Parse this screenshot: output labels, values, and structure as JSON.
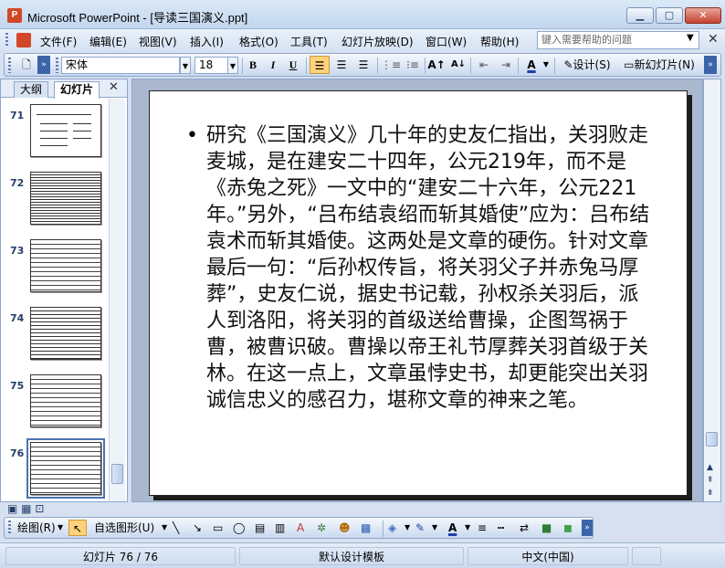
{
  "window": {
    "title": "Microsoft PowerPoint - [导读三国演义.ppt]",
    "app_icon_letter": "P"
  },
  "menu": {
    "items": [
      "文件(F)",
      "编辑(E)",
      "视图(V)",
      "插入(I)",
      "格式(O)",
      "工具(T)",
      "幻灯片放映(D)",
      "窗口(W)",
      "帮助(H)"
    ],
    "help_placeholder": "键入需要帮助的问题"
  },
  "toolbar": {
    "font_name": "宋体",
    "font_size": "18",
    "bold": "B",
    "italic": "I",
    "underline": "U",
    "design_label": "设计(S)",
    "new_slide_label": "新幻灯片(N)"
  },
  "left_pane": {
    "tabs": [
      "大纲",
      "幻灯片"
    ],
    "active_tab": "幻灯片",
    "slides": [
      {
        "number": "71"
      },
      {
        "number": "72"
      },
      {
        "number": "73"
      },
      {
        "number": "74"
      },
      {
        "number": "75"
      },
      {
        "number": "76",
        "selected": true
      }
    ]
  },
  "slide": {
    "bullet": "•",
    "text": "研究《三国演义》几十年的史友仁指出，关羽败走麦城，是在建安二十四年，公元219年，而不是《赤兔之死》一文中的“建安二十六年，公元221年。”另外，“吕布结袁绍而斩其婚使”应为：吕布结袁术而斩其婚使。这两处是文章的硬伤。针对文章最后一句：“后孙权传旨，将关羽父子并赤兔马厚葬”，史友仁说，据史书记载，孙权杀关羽后，派人到洛阳，将关羽的首级送给曹操，企图驾祸于曹，被曹识破。曹操以帝王礼节厚葬关羽首级于关林。在这一点上，文章虽悖史书，却更能突出关羽诚信忠义的感召力，堪称文章的神来之笔。"
  },
  "draw_toolbar": {
    "draw_label": "绘图(R)",
    "autoshapes_label": "自选图形(U)"
  },
  "status": {
    "slide_position": "幻灯片 76 / 76",
    "template": "默认设计模板",
    "language": "中文(中国)"
  },
  "colors": {
    "accent": "#4a73b0",
    "office_red": "#d24726",
    "font_color_bar": "#1f3fa8"
  }
}
